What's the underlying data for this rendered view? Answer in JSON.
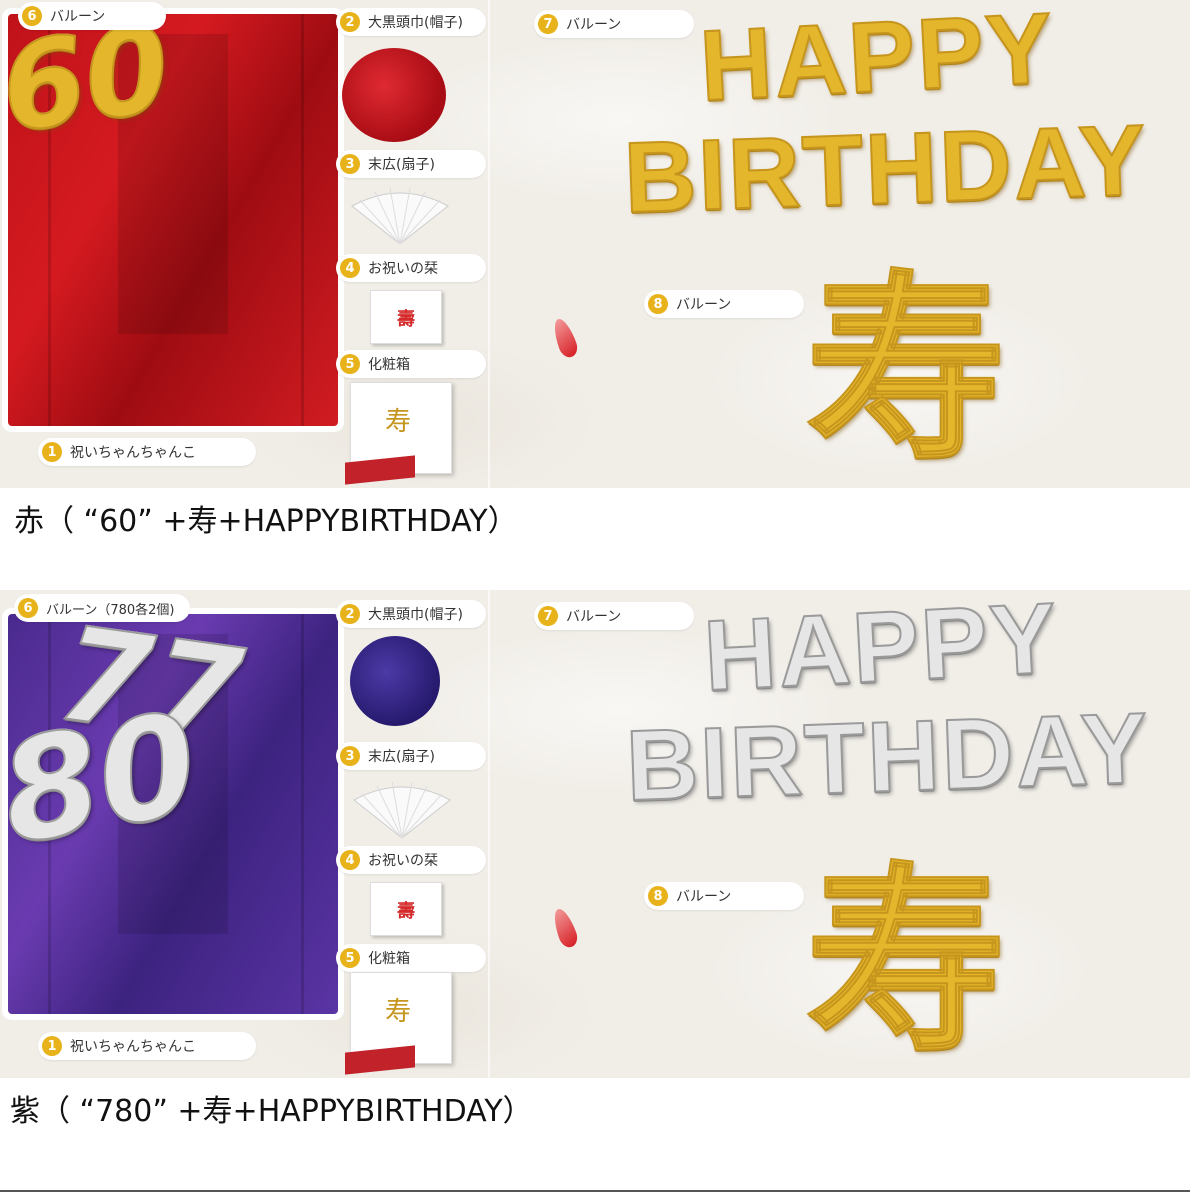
{
  "top": {
    "items": [
      {
        "num": "6",
        "label": "バルーン"
      },
      {
        "num": "2",
        "label": "大黒頭巾(帽子)"
      },
      {
        "num": "3",
        "label": "末広(扇子)"
      },
      {
        "num": "4",
        "label": "お祝いの栞"
      },
      {
        "num": "5",
        "label": "化粧箱"
      },
      {
        "num": "1",
        "label": "祝いちゃんちゃんこ"
      },
      {
        "num": "7",
        "label": "バルーン"
      },
      {
        "num": "8",
        "label": "バルーン"
      }
    ],
    "balloon_number": "60",
    "balloon_line1": "HAPPY",
    "balloon_line2": "BIRTHDAY",
    "balloon_kanji": "寿",
    "card_kanji": "壽",
    "box_kanji": "寿",
    "caption": "赤（ “60” +寿+HAPPYBIRTHDAY）",
    "colors": {
      "garment": "#c0121a",
      "balloon_text": "#e3b62b",
      "hat": "#c0121a"
    }
  },
  "bottom": {
    "items": [
      {
        "num": "6",
        "label": "バルーン（780各2個)"
      },
      {
        "num": "2",
        "label": "大黒頭巾(帽子)"
      },
      {
        "num": "3",
        "label": "末広(扇子)"
      },
      {
        "num": "4",
        "label": "お祝いの栞"
      },
      {
        "num": "5",
        "label": "化粧箱"
      },
      {
        "num": "1",
        "label": "祝いちゃんちゃんこ"
      },
      {
        "num": "7",
        "label": "バルーン"
      },
      {
        "num": "8",
        "label": "バルーン"
      }
    ],
    "balloon_number_a": "77",
    "balloon_number_b": "80",
    "balloon_line1": "HAPPY",
    "balloon_line2": "BIRTHDAY",
    "balloon_kanji": "寿",
    "card_kanji": "壽",
    "box_kanji": "寿",
    "caption": "紫（ “780” +寿+HAPPYBIRTHDAY）",
    "colors": {
      "garment": "#4a2a8e",
      "balloon_text": "#e6e6e6",
      "hat": "#2e2080"
    }
  }
}
